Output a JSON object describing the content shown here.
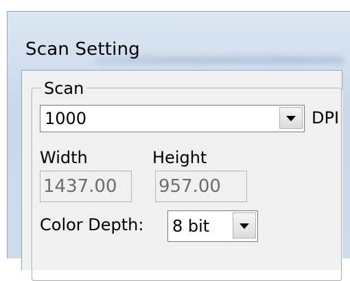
{
  "window": {
    "title": "Scan Setting"
  },
  "scan_group": {
    "legend": "Scan",
    "dpi": {
      "value": "1000",
      "unit_label": "DPI"
    },
    "width": {
      "label": "Width",
      "value": "1437.00"
    },
    "height": {
      "label": "Height",
      "value": "957.00"
    },
    "color_depth": {
      "label": "Color Depth:",
      "value": "8 bit"
    }
  },
  "icons": {
    "dropdown": "chevron-down-icon"
  }
}
